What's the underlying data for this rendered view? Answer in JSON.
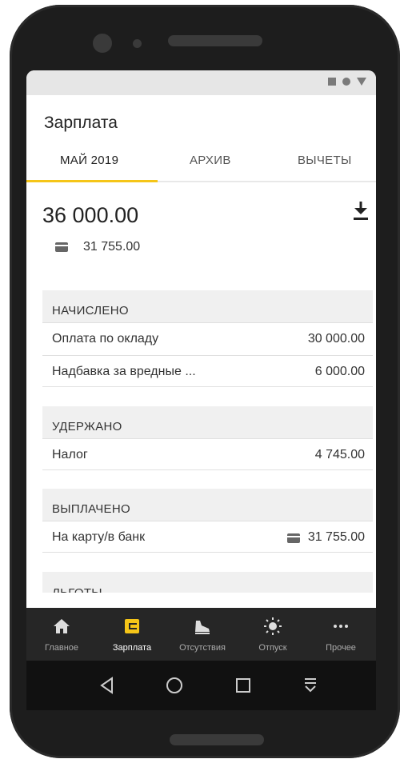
{
  "app": {
    "title": "Зарплата"
  },
  "tabs": [
    {
      "label": "МАЙ 2019",
      "active": true
    },
    {
      "label": "АРХИВ",
      "active": false
    },
    {
      "label": "ВЫЧЕТЫ",
      "active": false
    }
  ],
  "summary": {
    "total": "36 000.00",
    "card_amount": "31 755.00"
  },
  "sections": {
    "accrued": {
      "title": "НАЧИСЛЕНО",
      "rows": [
        {
          "label": "Оплата по окладу",
          "value": "30 000.00"
        },
        {
          "label": "Надбавка за вредные ...",
          "value": "6 000.00"
        }
      ]
    },
    "withheld": {
      "title": "УДЕРЖАНО",
      "rows": [
        {
          "label": "Налог",
          "value": "4 745.00"
        }
      ]
    },
    "paid": {
      "title": "ВЫПЛАЧЕНО",
      "rows": [
        {
          "label": "На карту/в банк",
          "value": "31 755.00",
          "icon": "card-icon"
        }
      ]
    },
    "benefits": {
      "title": "ЛЬГОТЫ"
    }
  },
  "bottom_nav": [
    {
      "label": "Главное",
      "icon": "home-icon",
      "active": false
    },
    {
      "label": "Зарплата",
      "icon": "wallet-icon",
      "active": true
    },
    {
      "label": "Отсутствия",
      "icon": "shoe-icon",
      "active": false
    },
    {
      "label": "Отпуск",
      "icon": "sun-icon",
      "active": false
    },
    {
      "label": "Прочее",
      "icon": "more-icon",
      "active": false
    }
  ],
  "colors": {
    "accent": "#f5c518",
    "nav_bg": "#262626",
    "section_bg": "#f0f0f0"
  }
}
